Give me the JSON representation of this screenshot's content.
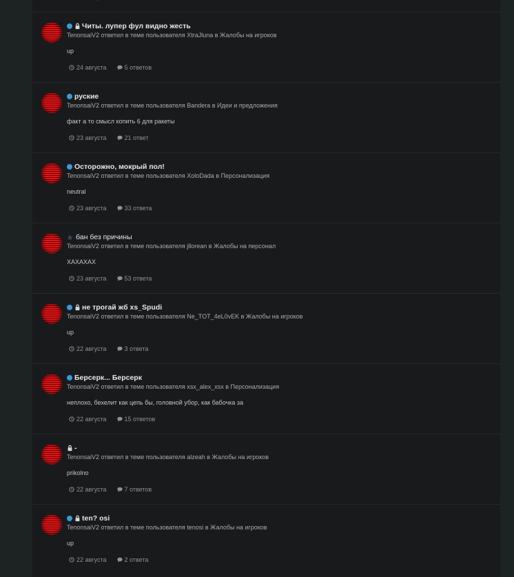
{
  "top_fragment": "–",
  "items": [
    {
      "title": "Читы. лупер фул видно жесть",
      "unread": true,
      "locked": true,
      "featured": false,
      "meta": "TenonsaiV2 ответил в теме пользователя XtraJluna в Жалобы на игроков",
      "snippet": "up",
      "date": "24 августа",
      "replies": "5 ответов"
    },
    {
      "title": "руские",
      "unread": true,
      "locked": false,
      "featured": false,
      "meta": "TenonsaiV2 ответил в теме пользователя Bandera в Идеи и предложения",
      "snippet": "факт а то смысл копить 6 для ракеты",
      "date": "23 августа",
      "replies": "21 ответ"
    },
    {
      "title": "Осторожно, мокрый пол!",
      "unread": true,
      "locked": false,
      "featured": false,
      "meta": "TenonsaiV2 ответил в теме пользователя XoloDada в Персонализация",
      "snippet": "neutral",
      "date": "23 августа",
      "replies": "33 ответа"
    },
    {
      "title": "бан без причины",
      "unread": false,
      "locked": false,
      "featured": true,
      "meta": "TenonsaiV2 ответил в теме пользователя jllorean в Жалобы на персонал",
      "snippet": "ХАХАХАХ",
      "date": "23 августа",
      "replies": "53 ответа"
    },
    {
      "title": "не трогай жб xs_Spudi",
      "unread": true,
      "locked": true,
      "featured": false,
      "meta": "TenonsaiV2 ответил в теме пользователя Ne_TOT_4eL0vEK в Жалобы на игроков",
      "snippet": "up",
      "date": "22 августа",
      "replies": "3 ответа"
    },
    {
      "title": "Берсерк... Берсерк",
      "unread": true,
      "locked": false,
      "featured": false,
      "meta": "TenonsaiV2 ответил в теме пользователя xsx_alex_xsx в Персонализация",
      "snippet": "неплохо, бехелит как цепь бы, головной убор, как бабочка за",
      "date": "22 августа",
      "replies": "15 ответов"
    },
    {
      "title": "-",
      "unread": false,
      "locked": true,
      "featured": false,
      "meta": "TenonsaiV2 ответил в теме пользователя alzeah в Жалобы на игроков",
      "snippet": "prikolno",
      "date": "22 августа",
      "replies": "7 ответов"
    },
    {
      "title": "ten? osi",
      "unread": true,
      "locked": true,
      "featured": false,
      "meta": "TenonsaiV2 ответил в теме пользователя tenosi в Жалобы на игроков",
      "snippet": "up",
      "date": "22 августа",
      "replies": "2 ответа"
    }
  ],
  "colors": {
    "unread_dot": "#3a9ad9",
    "panel": "#181a1c",
    "page": "#1d2223"
  },
  "icons": {
    "unread": "unread-dot-icon",
    "lock": "lock-icon",
    "featured": "star-icon",
    "date": "clock-icon",
    "replies": "comment-icon"
  }
}
